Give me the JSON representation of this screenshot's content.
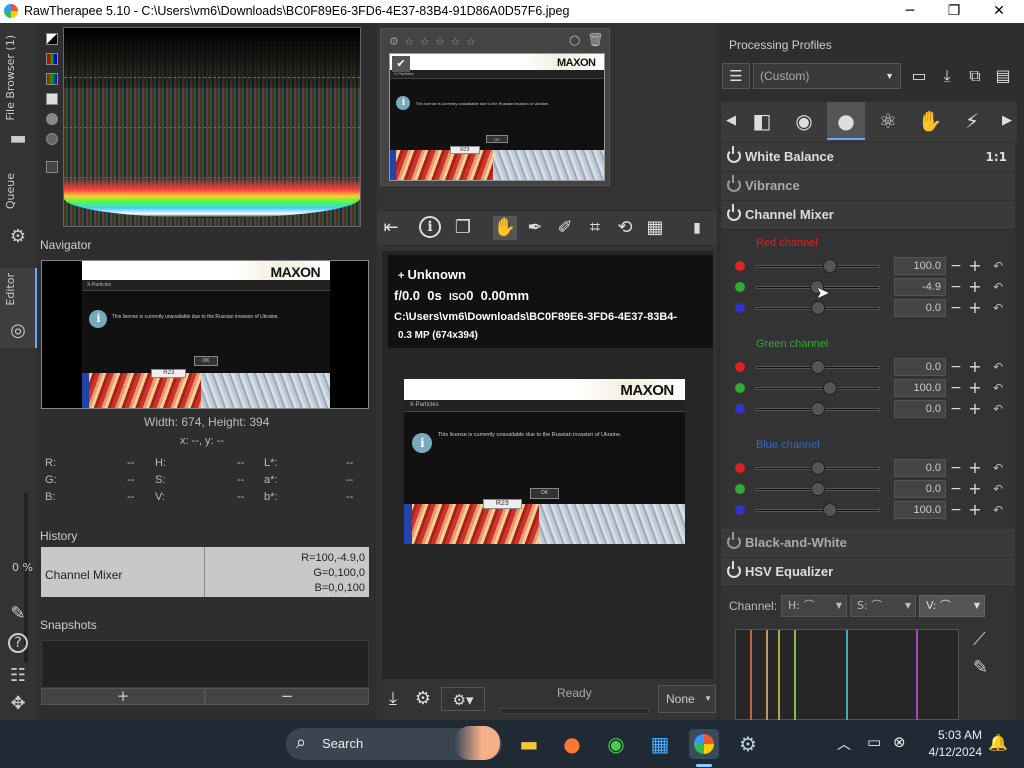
{
  "window": {
    "title": "RawTherapee 5.10 - C:\\Users\\vm6\\Downloads\\BC0F89E6-3FD6-4E37-83B4-91D86A0D57F6.jpeg",
    "minimize": "─",
    "maximize": "❐",
    "close": "✕"
  },
  "left_strip": {
    "tabs": [
      "File Browser (1)",
      "Queue",
      "Editor"
    ],
    "progress": "0 %"
  },
  "navigator": {
    "title": "Navigator",
    "size_text": "Width: 674, Height: 394",
    "coords": "x: --, y: --",
    "readouts": [
      {
        "label": "R:",
        "value": "--"
      },
      {
        "label": "H:",
        "value": "--"
      },
      {
        "label": "L*:",
        "value": "--"
      },
      {
        "label": "G:",
        "value": "--"
      },
      {
        "label": "S:",
        "value": "--"
      },
      {
        "label": "a*:",
        "value": "--"
      },
      {
        "label": "B:",
        "value": "--"
      },
      {
        "label": "V:",
        "value": "--"
      },
      {
        "label": "b*:",
        "value": "--"
      }
    ]
  },
  "history": {
    "title": "History",
    "item_label": "Channel Mixer",
    "item_value_lines": [
      "R=100,-4.9,0",
      "G=0,100,0",
      "B=0,0,100"
    ]
  },
  "snapshots": {
    "title": "Snapshots",
    "add": "+",
    "remove": "−"
  },
  "thumbnail_image": {
    "logo": "MAXON",
    "bar_text": "X-Particles",
    "message": "This license is currently unavailable due to the Russian invasion of Ukraine.",
    "ok": "OK",
    "r23": "R23",
    "info": "i"
  },
  "image_info": {
    "camera": "Unknown",
    "aperture": "f/0.0",
    "shutter": "0s",
    "iso_label": "ISO",
    "iso": "0",
    "focal": "0.00mm",
    "path": "C:\\Users\\vm6\\Downloads\\BC0F89E6-3FD6-4E37-83B4-",
    "size": "0.3 MP (674x394)"
  },
  "status": {
    "ready": "Ready",
    "profile_select": "None"
  },
  "processing_profiles": {
    "title": "Processing Profiles",
    "selected": "(Custom)"
  },
  "tools": {
    "white_balance": "White Balance",
    "white_balance_ratio": "1:1",
    "vibrance": "Vibrance",
    "channel_mixer": "Channel Mixer",
    "red_channel": "Red channel",
    "green_channel": "Green channel",
    "blue_channel": "Blue channel",
    "black_and_white": "Black-and-White",
    "hsv_equalizer": "HSV Equalizer",
    "hsv_channel_label": "Channel:",
    "hsv_h": "H:",
    "hsv_s": "S:",
    "hsv_v": "V:"
  },
  "mixer": {
    "red": [
      {
        "value": "100.0",
        "pos": 0.6,
        "color": "#d22"
      },
      {
        "value": "-4.9",
        "pos": 0.49,
        "color": "#3a3"
      },
      {
        "value": "0.0",
        "pos": 0.5,
        "color": "#33c"
      }
    ],
    "green": [
      {
        "value": "0.0",
        "pos": 0.5,
        "color": "#d22"
      },
      {
        "value": "100.0",
        "pos": 0.6,
        "color": "#3a3"
      },
      {
        "value": "0.0",
        "pos": 0.5,
        "color": "#33c"
      }
    ],
    "blue": [
      {
        "value": "0.0",
        "pos": 0.5,
        "color": "#d22"
      },
      {
        "value": "0.0",
        "pos": 0.5,
        "color": "#3a3"
      },
      {
        "value": "100.0",
        "pos": 0.6,
        "color": "#33c"
      }
    ]
  },
  "taskbar": {
    "search": "Search",
    "time": "5:03 AM",
    "date": "4/12/2024"
  }
}
